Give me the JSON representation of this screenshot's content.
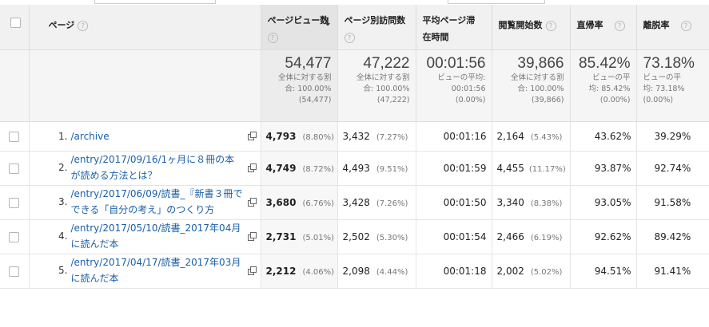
{
  "columns": {
    "page": "ページ",
    "pageviews": "ページビュー数",
    "unique": "ページ別訪問数",
    "avg_time": "平均ページ滞在時間",
    "entrances": "閲覧開始数",
    "bounce": "直帰率",
    "exit": "離脱率",
    "help": "?"
  },
  "totals": {
    "pageviews": {
      "big": "54,477",
      "l1": "全体に対する割",
      "l2": "合: 100.00%",
      "l3": "(54,477)"
    },
    "unique": {
      "big": "47,222",
      "l1": "全体に対する割",
      "l2": "合: 100.00%",
      "l3": "(47,222)"
    },
    "avg_time": {
      "big": "00:01:56",
      "l1": "ビューの平均:",
      "l2": "00:01:56",
      "l3": "(0.00%)"
    },
    "entrances": {
      "big": "39,866",
      "l1": "全体に対する割",
      "l2": "合: 100.00%",
      "l3": "(39,866)"
    },
    "bounce": {
      "big": "85.42%",
      "l1": "ビューの平",
      "l2": "均: 85.42%",
      "l3": "(0.00%)"
    },
    "exit": {
      "big": "73.18%",
      "l1": "ビューの平",
      "l2": "均: 73.18%",
      "l3": "(0.00%)"
    }
  },
  "rows": [
    {
      "n": "1.",
      "page": "/archive",
      "pv": "4,793",
      "pv_pct": "(8.80%)",
      "uv": "3,432",
      "uv_pct": "(7.27%)",
      "time": "00:01:16",
      "ent": "2,164",
      "ent_pct": "(5.43%)",
      "bounce": "43.62%",
      "exit": "39.29%"
    },
    {
      "n": "2.",
      "page": "/entry/2017/09/16/1ヶ月に８冊の本が読める方法とは？",
      "pv": "4,749",
      "pv_pct": "(8.72%)",
      "uv": "4,493",
      "uv_pct": "(9.51%)",
      "time": "00:01:59",
      "ent": "4,455",
      "ent_pct": "(11.17%)",
      "bounce": "93.87%",
      "exit": "92.74%"
    },
    {
      "n": "3.",
      "page": "/entry/2017/06/09/読書_『新書３冊でできる「自分の考え」のつくり方",
      "pv": "3,680",
      "pv_pct": "(6.76%)",
      "uv": "3,428",
      "uv_pct": "(7.26%)",
      "time": "00:01:50",
      "ent": "3,340",
      "ent_pct": "(8.38%)",
      "bounce": "93.05%",
      "exit": "91.58%"
    },
    {
      "n": "4.",
      "page": "/entry/2017/05/10/読書_2017年04月に読んだ本",
      "pv": "2,731",
      "pv_pct": "(5.01%)",
      "uv": "2,502",
      "uv_pct": "(5.30%)",
      "time": "00:01:54",
      "ent": "2,466",
      "ent_pct": "(6.19%)",
      "bounce": "92.62%",
      "exit": "89.42%"
    },
    {
      "n": "5.",
      "page": "/entry/2017/04/17/読書_2017年03月に読んだ本",
      "pv": "2,212",
      "pv_pct": "(4.06%)",
      "uv": "2,098",
      "uv_pct": "(4.44%)",
      "time": "00:01:18",
      "ent": "2,002",
      "ent_pct": "(5.02%)",
      "bounce": "94.51%",
      "exit": "91.41%"
    }
  ]
}
